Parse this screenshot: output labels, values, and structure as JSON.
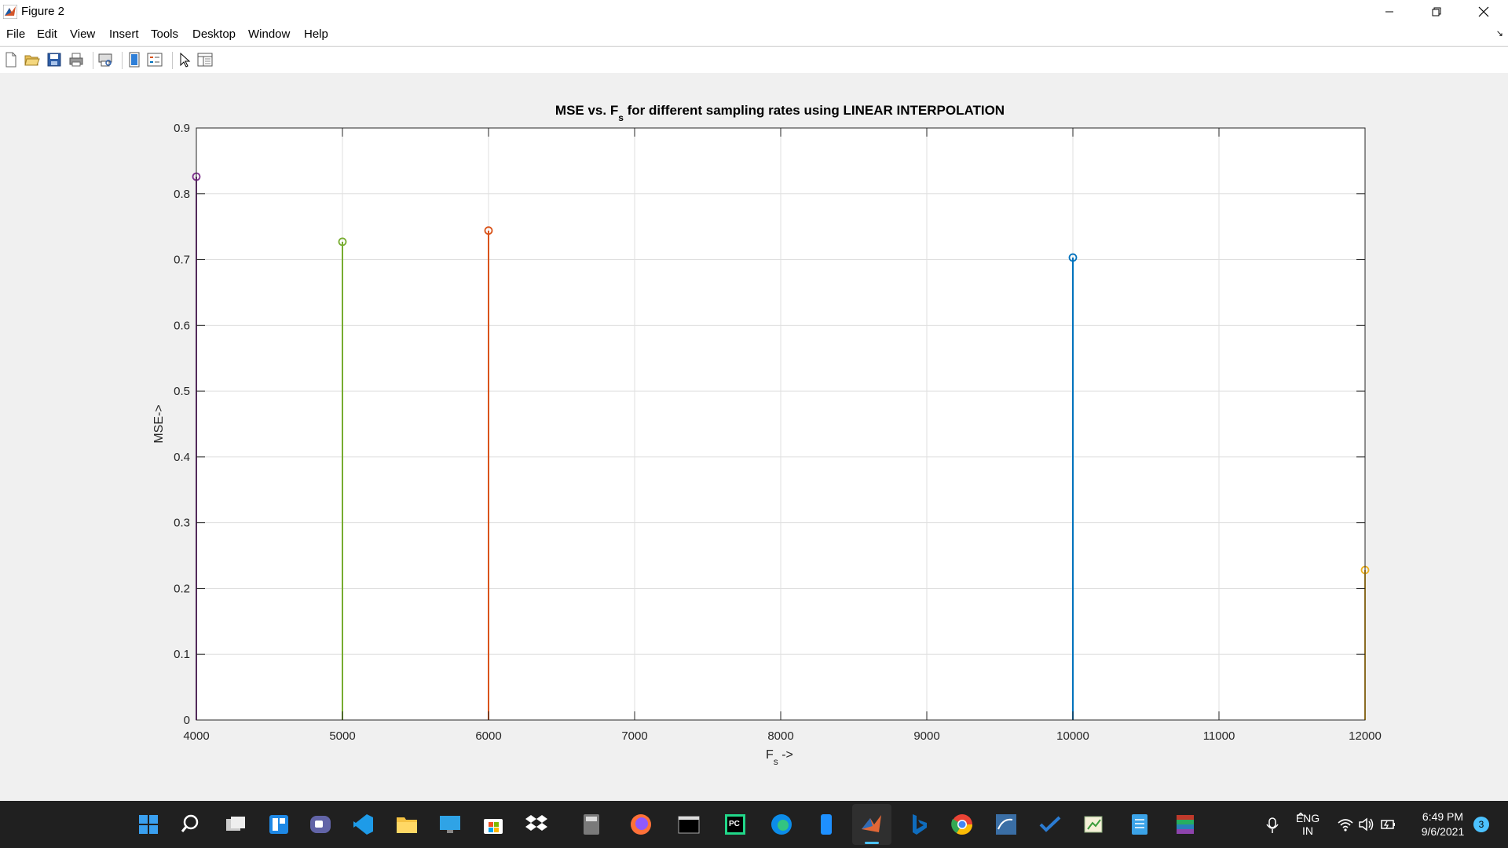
{
  "window": {
    "title": "Figure 2"
  },
  "menu": [
    "File",
    "Edit",
    "View",
    "Insert",
    "Tools",
    "Desktop",
    "Window",
    "Help"
  ],
  "toolbar_icons": [
    "new-figure-icon",
    "open-file-icon",
    "save-icon",
    "print-icon",
    "print-preview-icon",
    "link-plot-icon",
    "insert-legend-icon",
    "select-pointer-icon",
    "property-inspector-icon"
  ],
  "chart_data": {
    "type": "stem",
    "title": "MSE vs. F",
    "title_sub": "s",
    "title_rest": " for different sampling rates using LINEAR INTERPOLATION",
    "xlabel": "F",
    "xlabel_sub": "s",
    "xlabel_rest": " ->",
    "ylabel": "MSE->",
    "xlim": [
      4000,
      12000
    ],
    "ylim": [
      0,
      0.9
    ],
    "xticks": [
      4000,
      5000,
      6000,
      7000,
      8000,
      9000,
      10000,
      11000,
      12000
    ],
    "yticks": [
      0,
      0.1,
      0.2,
      0.3,
      0.4,
      0.5,
      0.6,
      0.7,
      0.8,
      0.9
    ],
    "grid": true,
    "series": [
      {
        "x": 10000,
        "y": 0.703,
        "color": "#0072BD"
      },
      {
        "x": 6000,
        "y": 0.744,
        "color": "#D95319"
      },
      {
        "x": 12000,
        "y": 0.228,
        "color": "#EDB120"
      },
      {
        "x": 4000,
        "y": 0.826,
        "color": "#7E2F8E"
      },
      {
        "x": 5000,
        "y": 0.727,
        "color": "#77AC30"
      }
    ]
  },
  "taskbar": {
    "icons": [
      "windows-start-icon",
      "search-icon",
      "task-view-icon",
      "widgets-icon",
      "teams-chat-icon",
      "vscode-icon",
      "file-explorer-icon",
      "remote-desktop-icon",
      "microsoft-store-icon",
      "dropbox-icon",
      "calculator-icon",
      "firefox-icon",
      "terminal-icon",
      "pycharm-icon",
      "edge-icon",
      "phone-icon",
      "matlab-icon",
      "bing-icon",
      "chrome-icon",
      "mysql-workbench-icon",
      "todo-icon",
      "paint-icon",
      "notepad-icon",
      "winrar-icon"
    ],
    "lang_top": "ENG",
    "lang_bottom": "IN",
    "time": "6:49 PM",
    "date": "9/6/2021",
    "notification_count": "3"
  }
}
